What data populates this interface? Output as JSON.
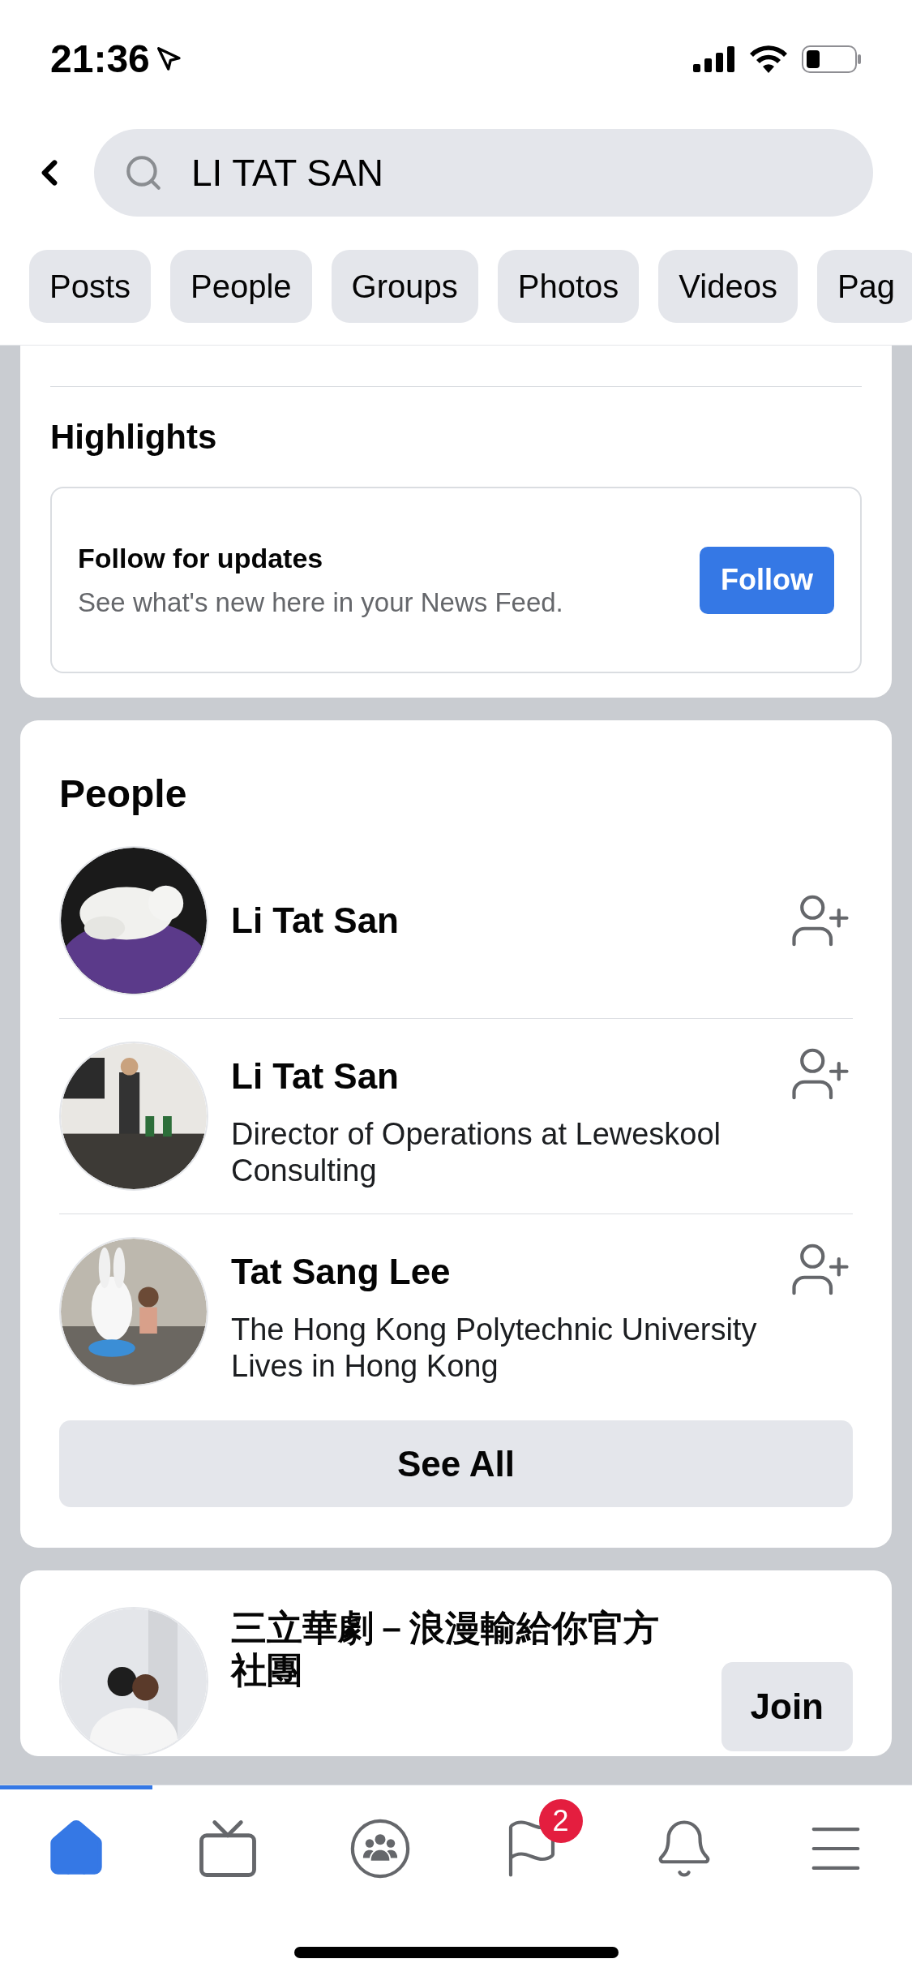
{
  "status_bar": {
    "time": "21:36"
  },
  "search": {
    "value": "LI TAT SAN"
  },
  "filters": [
    {
      "label": "Posts"
    },
    {
      "label": "People"
    },
    {
      "label": "Groups"
    },
    {
      "label": "Photos"
    },
    {
      "label": "Videos"
    },
    {
      "label": "Pag"
    }
  ],
  "highlights": {
    "title": "Highlights",
    "heading": "Follow for updates",
    "text": "See what's new here in your News Feed.",
    "button": "Follow"
  },
  "people": {
    "title": "People",
    "items": [
      {
        "name": "Li Tat San",
        "kind": "picture"
      },
      {
        "name": "Li Tat San",
        "lines": [
          "Director of Operations at Leweskool Consulting"
        ],
        "kind": "picture"
      },
      {
        "name": "Tat Sang Lee",
        "lines": [
          "The Hong Kong Polytechnic University",
          "Lives in Hong Kong"
        ],
        "kind": "picture"
      }
    ],
    "see_all": "See All"
  },
  "group": {
    "name": "三立華劇－浪漫輸給你官方社團",
    "button": "Join"
  },
  "tab_bar": [
    {
      "kind": "home",
      "selected": true
    },
    {
      "kind": "watch",
      "selected": false
    },
    {
      "kind": "groups",
      "selected": false
    },
    {
      "kind": "pages",
      "selected": false,
      "badge": "2"
    },
    {
      "kind": "notifications",
      "selected": false
    },
    {
      "kind": "menu",
      "selected": false
    }
  ]
}
